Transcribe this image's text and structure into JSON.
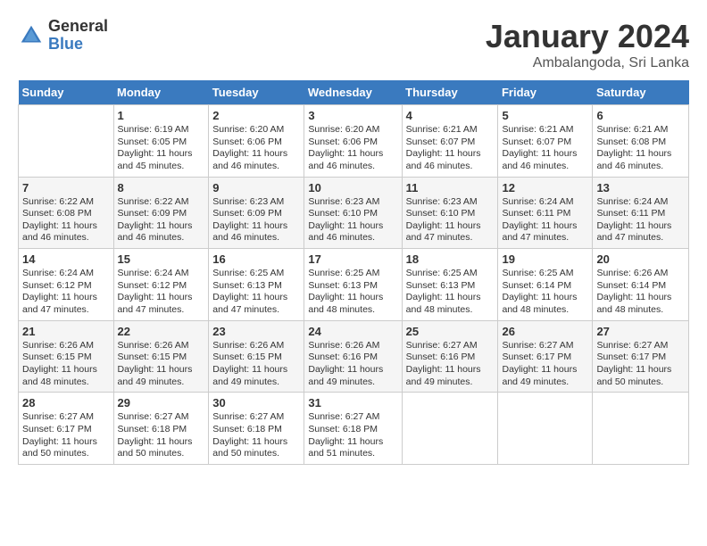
{
  "header": {
    "logo": {
      "general": "General",
      "blue": "Blue"
    },
    "title": "January 2024",
    "location": "Ambalangoda, Sri Lanka"
  },
  "weekdays": [
    "Sunday",
    "Monday",
    "Tuesday",
    "Wednesday",
    "Thursday",
    "Friday",
    "Saturday"
  ],
  "weeks": [
    [
      {
        "day": "",
        "info": ""
      },
      {
        "day": "1",
        "info": "Sunrise: 6:19 AM\nSunset: 6:05 PM\nDaylight: 11 hours\nand 45 minutes."
      },
      {
        "day": "2",
        "info": "Sunrise: 6:20 AM\nSunset: 6:06 PM\nDaylight: 11 hours\nand 46 minutes."
      },
      {
        "day": "3",
        "info": "Sunrise: 6:20 AM\nSunset: 6:06 PM\nDaylight: 11 hours\nand 46 minutes."
      },
      {
        "day": "4",
        "info": "Sunrise: 6:21 AM\nSunset: 6:07 PM\nDaylight: 11 hours\nand 46 minutes."
      },
      {
        "day": "5",
        "info": "Sunrise: 6:21 AM\nSunset: 6:07 PM\nDaylight: 11 hours\nand 46 minutes."
      },
      {
        "day": "6",
        "info": "Sunrise: 6:21 AM\nSunset: 6:08 PM\nDaylight: 11 hours\nand 46 minutes."
      }
    ],
    [
      {
        "day": "7",
        "info": "Sunrise: 6:22 AM\nSunset: 6:08 PM\nDaylight: 11 hours\nand 46 minutes."
      },
      {
        "day": "8",
        "info": "Sunrise: 6:22 AM\nSunset: 6:09 PM\nDaylight: 11 hours\nand 46 minutes."
      },
      {
        "day": "9",
        "info": "Sunrise: 6:23 AM\nSunset: 6:09 PM\nDaylight: 11 hours\nand 46 minutes."
      },
      {
        "day": "10",
        "info": "Sunrise: 6:23 AM\nSunset: 6:10 PM\nDaylight: 11 hours\nand 46 minutes."
      },
      {
        "day": "11",
        "info": "Sunrise: 6:23 AM\nSunset: 6:10 PM\nDaylight: 11 hours\nand 47 minutes."
      },
      {
        "day": "12",
        "info": "Sunrise: 6:24 AM\nSunset: 6:11 PM\nDaylight: 11 hours\nand 47 minutes."
      },
      {
        "day": "13",
        "info": "Sunrise: 6:24 AM\nSunset: 6:11 PM\nDaylight: 11 hours\nand 47 minutes."
      }
    ],
    [
      {
        "day": "14",
        "info": "Sunrise: 6:24 AM\nSunset: 6:12 PM\nDaylight: 11 hours\nand 47 minutes."
      },
      {
        "day": "15",
        "info": "Sunrise: 6:24 AM\nSunset: 6:12 PM\nDaylight: 11 hours\nand 47 minutes."
      },
      {
        "day": "16",
        "info": "Sunrise: 6:25 AM\nSunset: 6:13 PM\nDaylight: 11 hours\nand 47 minutes."
      },
      {
        "day": "17",
        "info": "Sunrise: 6:25 AM\nSunset: 6:13 PM\nDaylight: 11 hours\nand 48 minutes."
      },
      {
        "day": "18",
        "info": "Sunrise: 6:25 AM\nSunset: 6:13 PM\nDaylight: 11 hours\nand 48 minutes."
      },
      {
        "day": "19",
        "info": "Sunrise: 6:25 AM\nSunset: 6:14 PM\nDaylight: 11 hours\nand 48 minutes."
      },
      {
        "day": "20",
        "info": "Sunrise: 6:26 AM\nSunset: 6:14 PM\nDaylight: 11 hours\nand 48 minutes."
      }
    ],
    [
      {
        "day": "21",
        "info": "Sunrise: 6:26 AM\nSunset: 6:15 PM\nDaylight: 11 hours\nand 48 minutes."
      },
      {
        "day": "22",
        "info": "Sunrise: 6:26 AM\nSunset: 6:15 PM\nDaylight: 11 hours\nand 49 minutes."
      },
      {
        "day": "23",
        "info": "Sunrise: 6:26 AM\nSunset: 6:15 PM\nDaylight: 11 hours\nand 49 minutes."
      },
      {
        "day": "24",
        "info": "Sunrise: 6:26 AM\nSunset: 6:16 PM\nDaylight: 11 hours\nand 49 minutes."
      },
      {
        "day": "25",
        "info": "Sunrise: 6:27 AM\nSunset: 6:16 PM\nDaylight: 11 hours\nand 49 minutes."
      },
      {
        "day": "26",
        "info": "Sunrise: 6:27 AM\nSunset: 6:17 PM\nDaylight: 11 hours\nand 49 minutes."
      },
      {
        "day": "27",
        "info": "Sunrise: 6:27 AM\nSunset: 6:17 PM\nDaylight: 11 hours\nand 50 minutes."
      }
    ],
    [
      {
        "day": "28",
        "info": "Sunrise: 6:27 AM\nSunset: 6:17 PM\nDaylight: 11 hours\nand 50 minutes."
      },
      {
        "day": "29",
        "info": "Sunrise: 6:27 AM\nSunset: 6:18 PM\nDaylight: 11 hours\nand 50 minutes."
      },
      {
        "day": "30",
        "info": "Sunrise: 6:27 AM\nSunset: 6:18 PM\nDaylight: 11 hours\nand 50 minutes."
      },
      {
        "day": "31",
        "info": "Sunrise: 6:27 AM\nSunset: 6:18 PM\nDaylight: 11 hours\nand 51 minutes."
      },
      {
        "day": "",
        "info": ""
      },
      {
        "day": "",
        "info": ""
      },
      {
        "day": "",
        "info": ""
      }
    ]
  ]
}
